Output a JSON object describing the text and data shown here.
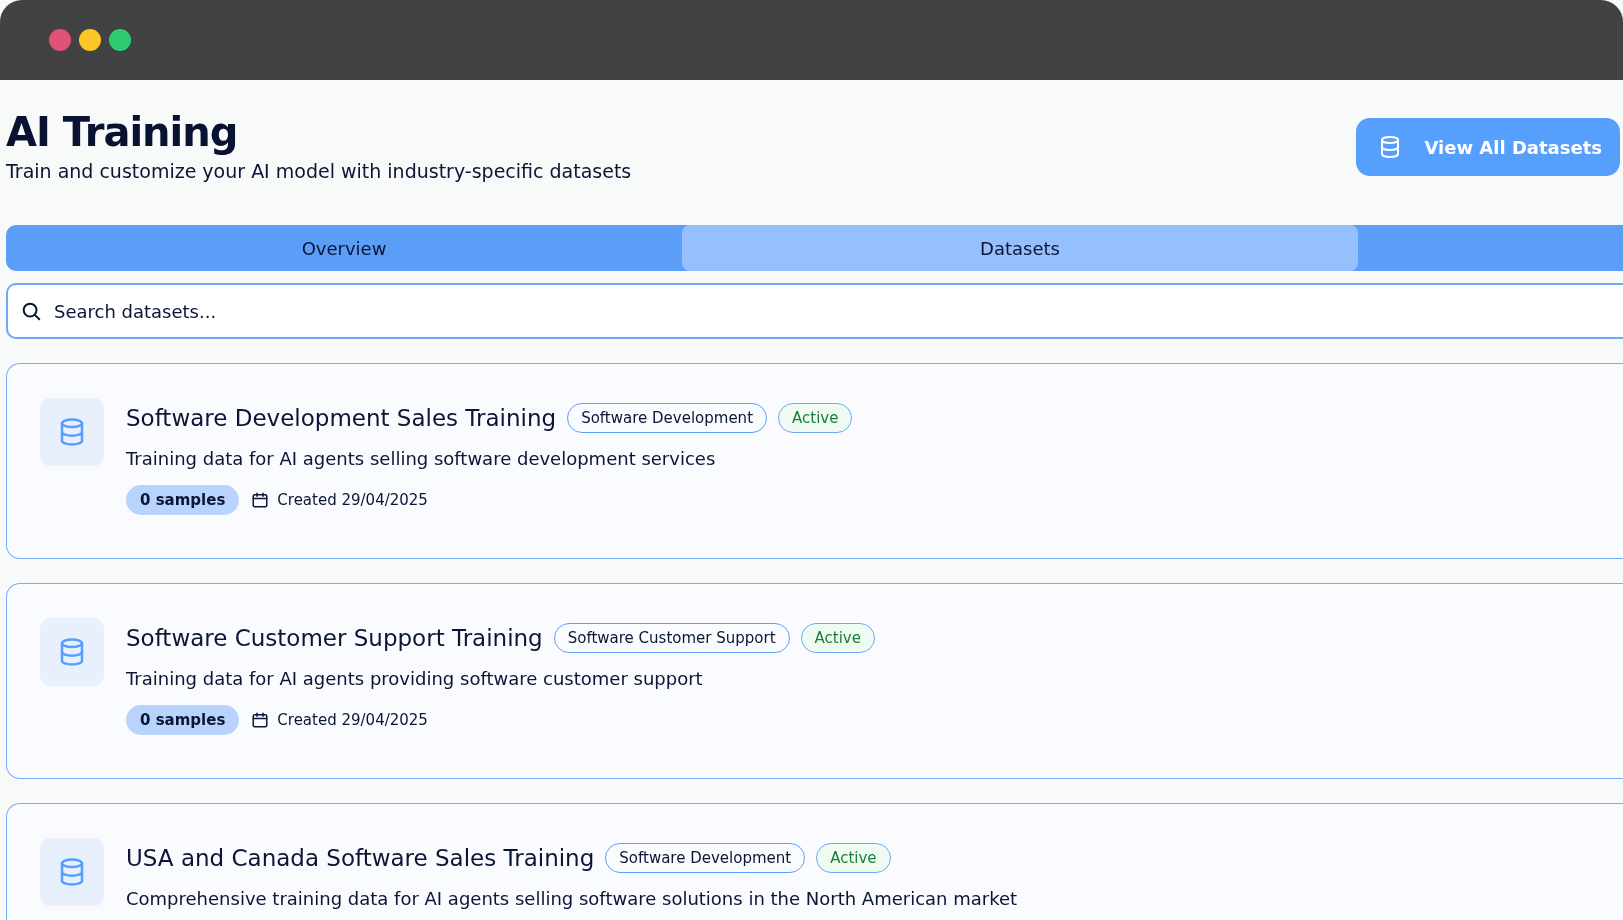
{
  "header": {
    "title": "AI Training",
    "subtitle": "Train and customize your AI model with industry-specific datasets",
    "action": "View All Datasets"
  },
  "tabs": [
    {
      "label": "Overview",
      "selected": false
    },
    {
      "label": "Datasets",
      "selected": true
    }
  ],
  "search": {
    "placeholder": "Search datasets..."
  },
  "datasets": [
    {
      "name": "Software Development Sales Training",
      "category": "Software Development",
      "status": "Active",
      "active": true,
      "description": "Training data for AI agents selling software development services",
      "samples": "0 samples",
      "created": "Created 29/04/2025"
    },
    {
      "name": "Software Customer Support Training",
      "category": "Software Customer Support",
      "status": "Active",
      "active": true,
      "description": "Training data for AI agents providing software customer support",
      "samples": "0 samples",
      "created": "Created 29/04/2025"
    },
    {
      "name": "USA and Canada Software Sales Training",
      "category": "Software Development",
      "status": "Active",
      "active": true,
      "description": "Comprehensive training data for AI agents selling software solutions in the North American market"
    }
  ]
}
